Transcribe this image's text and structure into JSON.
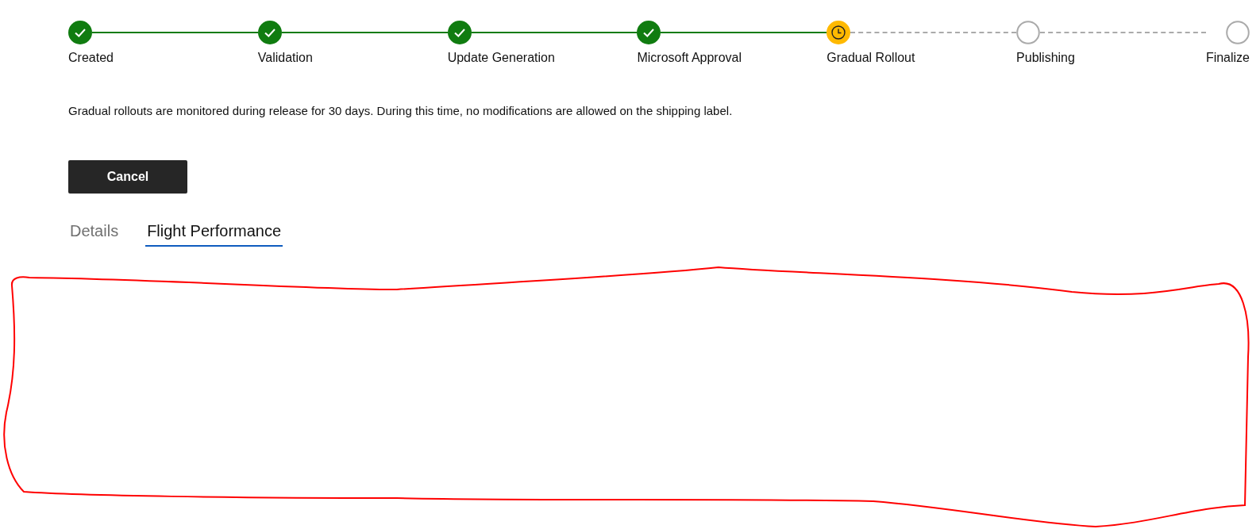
{
  "stepper": [
    {
      "label": "Created",
      "kind": "done"
    },
    {
      "label": "Validation",
      "kind": "done"
    },
    {
      "label": "Update Generation",
      "kind": "done"
    },
    {
      "label": "Microsoft Approval",
      "kind": "done"
    },
    {
      "label": "Gradual Rollout",
      "kind": "current"
    },
    {
      "label": "Publishing",
      "kind": "pending"
    },
    {
      "label": "Finalize",
      "kind": "pending"
    }
  ],
  "message": "Gradual rollouts are monitored during release for 30 days. During this time, no modifications are allowed on the shipping label.",
  "cancel_button": "Cancel",
  "tabs": [
    {
      "label": "Details",
      "selected": false
    },
    {
      "label": "Flight Performance",
      "selected": true
    }
  ],
  "annotation": {
    "kind": "freehand-outline",
    "color": "#ff0000"
  }
}
